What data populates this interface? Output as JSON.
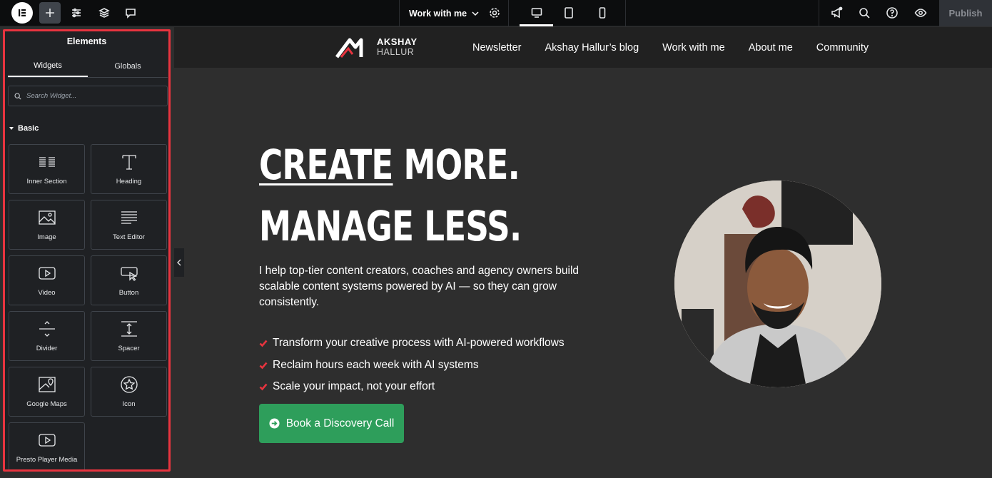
{
  "topbar": {
    "page_selector": "Work with me",
    "publish_label": "Publish",
    "icons": [
      "elementor-logo-icon",
      "plus-icon",
      "settings-sliders-icon",
      "layers-icon",
      "comment-icon",
      "gear-icon",
      "desktop-icon",
      "tablet-icon",
      "mobile-icon",
      "megaphone-icon",
      "search-icon",
      "help-icon",
      "eye-icon"
    ]
  },
  "panel": {
    "title": "Elements",
    "tabs": [
      {
        "label": "Widgets"
      },
      {
        "label": "Globals"
      }
    ],
    "search_placeholder": "Search Widget...",
    "category": "Basic",
    "widgets": [
      {
        "label": "Inner Section",
        "icon": "inner-section-icon"
      },
      {
        "label": "Heading",
        "icon": "heading-icon"
      },
      {
        "label": "Image",
        "icon": "image-icon"
      },
      {
        "label": "Text Editor",
        "icon": "text-editor-icon"
      },
      {
        "label": "Video",
        "icon": "video-icon"
      },
      {
        "label": "Button",
        "icon": "button-icon"
      },
      {
        "label": "Divider",
        "icon": "divider-icon"
      },
      {
        "label": "Spacer",
        "icon": "spacer-icon"
      },
      {
        "label": "Google Maps",
        "icon": "google-maps-icon"
      },
      {
        "label": "Icon",
        "icon": "star-icon"
      },
      {
        "label": "Presto Player Media",
        "icon": "video-icon"
      }
    ]
  },
  "site": {
    "brand_line1": "AKSHAY",
    "brand_line2": "HALLUR",
    "nav": [
      "Newsletter",
      "Akshay Hallur’s blog",
      "Work with me",
      "About me",
      "Community"
    ],
    "hero_title_1a": "CREATE",
    "hero_title_1b": " MORE.",
    "hero_title_2": "MANAGE LESS.",
    "hero_desc": "I help top-tier content creators, coaches and agency owners build scalable content systems powered by AI — so they can grow consistently.",
    "bullets": [
      "Transform your creative process with AI-powered workflows",
      "Reclaim hours each week with AI systems",
      "Scale your impact, not your effort"
    ],
    "cta_label": "Book a Discovery Call",
    "colors": {
      "accent_red": "#e8343f",
      "cta_green": "#2e9e5b",
      "panel_bg": "#1f2124",
      "canvas_bg": "#2e2e2e"
    }
  }
}
